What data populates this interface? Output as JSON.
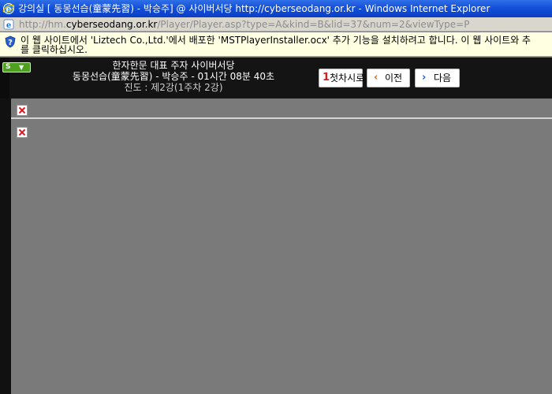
{
  "window": {
    "title": "강의실 [ 동몽선습(童蒙先習) - 박승주] @ 사이버서당 http://cyberseodang.or.kr - Windows Internet Explorer"
  },
  "address": {
    "prefix": "http://hm.",
    "host": "cyberseodang.or.kr",
    "path": "/Player/Player.asp?type=A&kind=B&lid=37&num=2&viewType=P"
  },
  "infobar": {
    "line1": "이 웹 사이트에서 'Liztech Co.,Ltd.'에서 배포한 'MSTPlayerInstaller.ocx' 추가 기능을 설치하려고 합니다. 이 웹 사이트와 추",
    "line2": "를 클릭하십시오."
  },
  "player": {
    "site_title": "한자한문 대표 주자 사이버서당",
    "course": "동몽선습(童蒙先習) - 박승주 - 01시간 08분 40초",
    "progress": "진도 : 제2강(1주차 2강)",
    "buttons": {
      "first": {
        "glyph": "1",
        "label": "첫차시로"
      },
      "prev": {
        "glyph": "‹",
        "label": "이전"
      },
      "next": {
        "glyph": "›",
        "label": "다음"
      }
    }
  },
  "colors": {
    "titlebar": "#1450d8",
    "infobar": "#ffffe1",
    "header": "#141414",
    "content": "#7a7a7a"
  }
}
